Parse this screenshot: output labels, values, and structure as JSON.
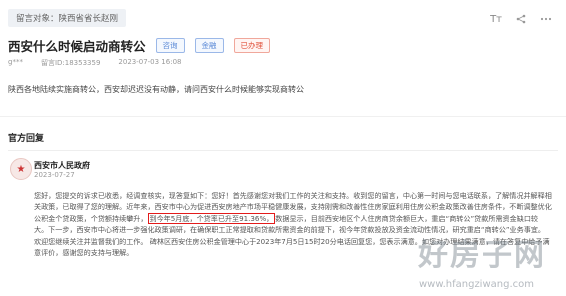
{
  "message_target": "留言对象：陕西省省长赵刚",
  "toolbar": {
    "font_icon": "Tт",
    "share_icon": "share-icon",
    "more_icon": "more-icon"
  },
  "title": "西安什么时候启动商转公",
  "badges": [
    "咨询",
    "金融",
    "已办理"
  ],
  "meta": {
    "author": "g***",
    "message_id": "留言ID:18353359",
    "datetime": "2023-07-03 16:08"
  },
  "question": "陕西各地陆续实施商转公，西安却迟迟没有动静，请问西安什么时候能够实现商转公",
  "section_title": "官方回复",
  "reply": {
    "org": "西安市人民政府",
    "date": "2023-07-27",
    "text_before": "您好，您提交的诉求已收悉，经调查核实，现答复如下：您好！首先感谢您对我们工作的关注和支持。收到您的留言，中心第一时间与您电话联系，了解情况并解释相关政策，已取得了您的理解。近年来，西安市中心为促进西安房地产市场平稳健康发展，支持刚需和改善性住房家庭利用住房公积金政策改善住房条件，不断调整优化公积金个贷政策，个贷额持续攀升，",
    "highlight": "到今年5月底，个贷率已升至91.36%，",
    "text_after": "数据显示，目前西安地区个人住房商贷余额巨大，重启“商转公”贷款所需资金缺口较大。下一步，西安市中心将进一步强化政策调研，在确保职工正常提取和贷款所需资金的前提下，视今年贷款投放及资金流动性情况，研究重启“商转公”业务事宜。欢迎您继续关注并监督我们的工作。 碑林区西安住房公积金管理中心于2023年7月5日15时20分电话回复您，您表示满意。如您对办理结果满意，请在答复中给予满意评价，感谢您的支持与理解。"
  },
  "watermark": {
    "logo": "好房子网",
    "url": "www.hfangziwang.com"
  }
}
